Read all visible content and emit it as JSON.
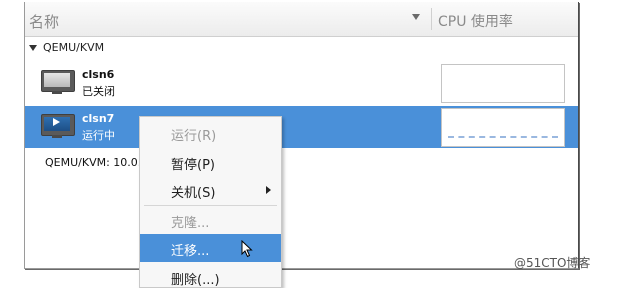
{
  "header": {
    "name_col": "名称",
    "cpu_col": "CPU 使用率"
  },
  "connection_group": {
    "label": "QEMU/KVM"
  },
  "vms": [
    {
      "name": "clsn6",
      "state": "已关闭",
      "selected": false,
      "icon": "vm-off-icon"
    },
    {
      "name": "clsn7",
      "state": "运行中",
      "selected": true,
      "icon": "vm-running-icon"
    }
  ],
  "second_connection": {
    "label": "QEMU/KVM: 10.0."
  },
  "context_menu": {
    "items": [
      {
        "label": "运行(R)",
        "enabled": false
      },
      {
        "label": "暂停(P)",
        "enabled": true
      },
      {
        "label": "关机(S)",
        "enabled": true,
        "submenu": true
      },
      {
        "label": "克隆...",
        "enabled": false
      },
      {
        "label": "迁移...",
        "enabled": true,
        "highlighted": true
      },
      {
        "label": "删除(...)",
        "enabled": true
      }
    ]
  },
  "watermark": "@51CTO博客",
  "colors": {
    "selection": "#4a90d9",
    "menu_bg": "#f7f7f7",
    "disabled_text": "#9a9a9a"
  }
}
